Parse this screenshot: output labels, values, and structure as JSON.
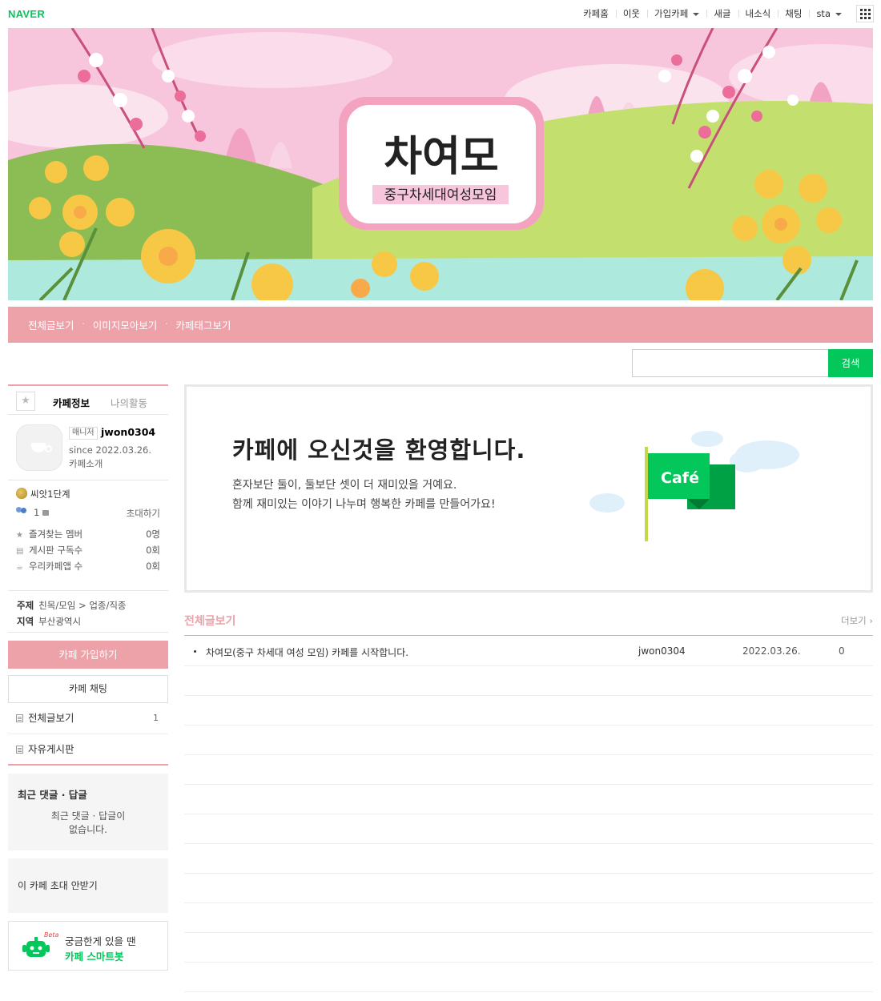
{
  "gnb": {
    "logo": "NAVER",
    "menu": [
      "카페홈",
      "이웃",
      "가입카페",
      "새글",
      "내소식",
      "채팅",
      "sta"
    ]
  },
  "banner": {
    "logo_title": "차여모",
    "logo_subtitle": "중구차세대여성모임"
  },
  "nav": {
    "links": [
      "전체글보기",
      "이미지모아보기",
      "카페태그보기"
    ]
  },
  "search": {
    "button": "검색",
    "placeholder": ""
  },
  "sidebar": {
    "tabs": {
      "info": "카페정보",
      "activity": "나의활동"
    },
    "profile": {
      "badge": "매니저",
      "nickname": "jwon0304",
      "since": "since 2022.03.26.",
      "intro": "카페소개"
    },
    "level": "씨앗1단계",
    "members": "1",
    "invite": "초대하기",
    "stats": [
      {
        "label": "즐겨찾는 멤버",
        "value": "0명",
        "icon": "star-icon"
      },
      {
        "label": "게시판 구독수",
        "value": "0회",
        "icon": "rss-icon"
      },
      {
        "label": "우리카페앱 수",
        "value": "0회",
        "icon": "app-icon"
      }
    ],
    "topic": {
      "label": "주제",
      "value": "친목/모임 > 업종/직종"
    },
    "region": {
      "label": "지역",
      "value": "부산광역시"
    },
    "join_button": "카페 가입하기",
    "chat_button": "카페 채팅",
    "menu": [
      {
        "label": "전체글보기",
        "count": "1"
      },
      {
        "label": "자유게시판",
        "count": ""
      }
    ],
    "recent": {
      "title": "최근 댓글 · 답글",
      "empty_line1": "최근 댓글 · 답글이",
      "empty_line2": "없습니다."
    },
    "no_invite": "이 카페 초대 안받기",
    "smartbot": {
      "beta": "Beta",
      "line1": "궁금한게 있을 땐",
      "line2": "카페 스마트봇"
    }
  },
  "welcome": {
    "title": "카페에 오신것을 환영합니다.",
    "desc1": "혼자보단 둘이, 둘보단 셋이 더 재미있을 거예요.",
    "desc2": "함께 재미있는 이야기 나누며 행복한 카페를 만들어가요!",
    "flag_text": "Café"
  },
  "list": {
    "title": "전체글보기",
    "more": "더보기 ›",
    "rows": [
      {
        "subject": "차여모(중구 차세대 여성 모임) 카페를 시작합니다.",
        "author": "jwon0304",
        "date": "2022.03.26.",
        "views": "0"
      }
    ]
  },
  "colors": {
    "accent": "#eda1a8",
    "brand": "#03c75a"
  }
}
